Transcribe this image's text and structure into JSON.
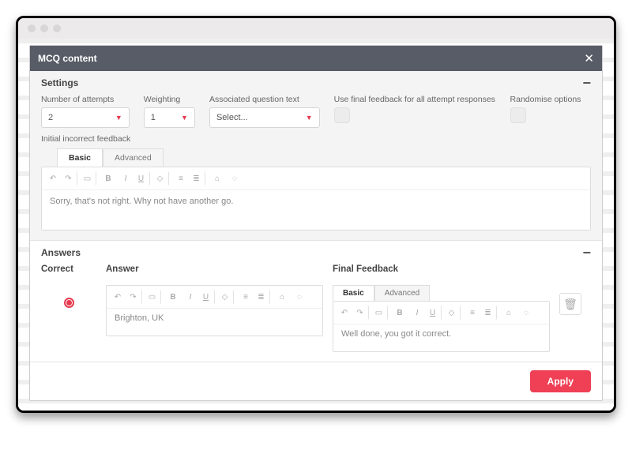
{
  "dialog": {
    "title": "MCQ content"
  },
  "settings": {
    "heading": "Settings",
    "fields": {
      "attempts": {
        "label": "Number of attempts",
        "value": "2"
      },
      "weighting": {
        "label": "Weighting",
        "value": "1"
      },
      "assocQuestion": {
        "label": "Associated question text",
        "value": "Select..."
      },
      "finalFeedback": {
        "label": "Use final feedback for all attempt responses"
      },
      "randomise": {
        "label": "Randomise options"
      }
    },
    "incorrectFeedback": {
      "label": "Initial incorrect feedback",
      "tabs": {
        "basic": "Basic",
        "advanced": "Advanced"
      },
      "text": "Sorry, that's not right. Why not have another go."
    }
  },
  "answers": {
    "heading": "Answers",
    "columns": {
      "correct": "Correct",
      "answer": "Answer",
      "feedback": "Final Feedback"
    },
    "row": {
      "answerText": "Brighton, UK",
      "feedbackTabs": {
        "basic": "Basic",
        "advanced": "Advanced"
      },
      "feedbackText": "Well done, you got it correct."
    }
  },
  "apply": {
    "label": "Apply"
  }
}
